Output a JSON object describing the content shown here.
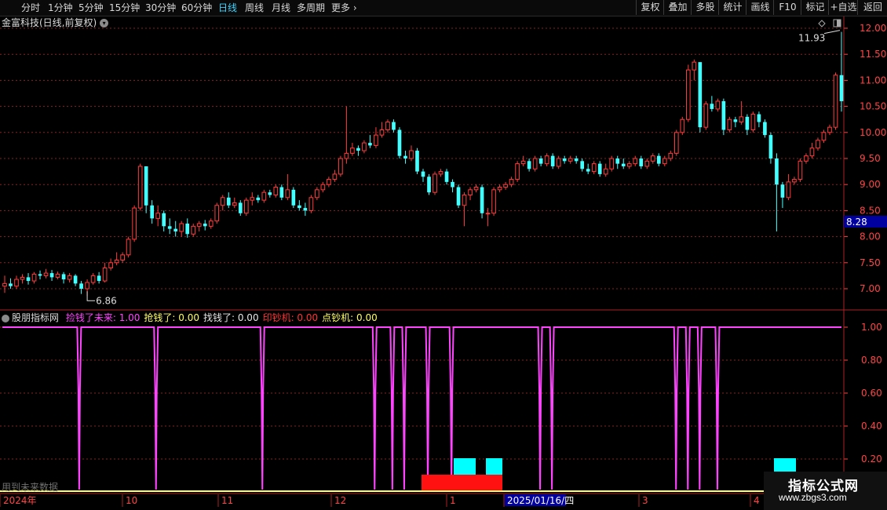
{
  "toolbar": {
    "periods": [
      "分时",
      "1分钟",
      "5分钟",
      "15分钟",
      "30分钟",
      "60分钟",
      "日线",
      "周线",
      "月线",
      "多周期"
    ],
    "more_label": "更多",
    "active_period": "日线",
    "right_buttons": [
      "复权",
      "叠加",
      "多股",
      "统计",
      "画线",
      "F10",
      "标记",
      "+自选",
      "返回"
    ]
  },
  "stock": {
    "title": "金富科技(日线,前复权)",
    "current_price_tag": "8.28",
    "high_label": "11.93",
    "low_label": "6.86"
  },
  "indicator": {
    "name": "股朋指标网",
    "items": [
      {
        "label": "捡钱了未来: 1.00",
        "color": "#ff44ff"
      },
      {
        "label": "抢钱了: 0.00",
        "color": "#ffff66"
      },
      {
        "label": "找钱了: 0.00",
        "color": "#e8e8e8"
      },
      {
        "label": "印钞机: 0.00",
        "color": "#ff3333"
      },
      {
        "label": "点钞机: 0.00",
        "color": "#ffff66"
      }
    ],
    "footnote": "用到未来数据"
  },
  "axes": {
    "price_ticks": [
      "12.00",
      "11.50",
      "11.00",
      "10.50",
      "10.00",
      "9.50",
      "9.00",
      "8.50",
      "8.00",
      "7.50",
      "7.00"
    ],
    "indicator_ticks": [
      "1.00",
      "0.80",
      "0.60",
      "0.40",
      "0.20"
    ],
    "time_labels": [
      "2024年",
      "10",
      "11",
      "12",
      "1",
      "2025/01/16/四",
      "3",
      "4"
    ]
  },
  "watermark": {
    "cn": "指标公式网",
    "en": "www.zbgs3.com"
  },
  "colors": {
    "up": "#ff3c3c",
    "down": "#44ffff",
    "indicator_line": "#ff44ff",
    "grid": "#882222",
    "baseline": "#ffff66"
  },
  "chart_data": [
    {
      "type": "candlestick",
      "series": [
        {
          "values": [
            [
              7.05,
              7.1,
              7.25,
              6.92
            ],
            [
              7.1,
              7.05,
              7.2,
              7.0
            ],
            [
              7.05,
              7.18,
              7.25,
              7.0
            ],
            [
              7.18,
              7.22,
              7.28,
              7.1
            ],
            [
              7.22,
              7.15,
              7.3,
              7.08
            ],
            [
              7.15,
              7.28,
              7.32,
              7.1
            ],
            [
              7.28,
              7.25,
              7.35,
              7.18
            ],
            [
              7.25,
              7.3,
              7.38,
              7.2
            ],
            [
              7.3,
              7.22,
              7.36,
              7.15
            ],
            [
              7.22,
              7.28,
              7.33,
              7.18
            ],
            [
              7.28,
              7.18,
              7.32,
              7.1
            ],
            [
              7.18,
              7.25,
              7.3,
              7.12
            ],
            [
              7.25,
              7.1,
              7.28,
              7.05
            ],
            [
              7.1,
              7.0,
              7.15,
              6.9
            ],
            [
              7.0,
              7.12,
              7.18,
              6.86
            ],
            [
              7.12,
              7.25,
              7.3,
              7.08
            ],
            [
              7.25,
              7.15,
              7.32,
              7.1
            ],
            [
              7.15,
              7.4,
              7.5,
              7.12
            ],
            [
              7.4,
              7.5,
              7.58,
              7.35
            ],
            [
              7.5,
              7.55,
              7.7,
              7.45
            ],
            [
              7.55,
              7.65,
              7.7,
              7.5
            ],
            [
              7.65,
              7.95,
              8.0,
              7.6
            ],
            [
              7.95,
              8.55,
              8.6,
              7.9
            ],
            [
              8.55,
              9.35,
              9.4,
              8.5
            ],
            [
              9.35,
              8.6,
              9.1,
              8.45
            ],
            [
              8.6,
              8.35,
              8.7,
              8.25
            ],
            [
              8.35,
              8.45,
              8.6,
              8.2
            ],
            [
              8.45,
              8.2,
              8.5,
              8.1
            ],
            [
              8.2,
              8.15,
              8.35,
              8.05
            ],
            [
              8.15,
              8.1,
              8.3,
              8.0
            ],
            [
              8.1,
              8.25,
              8.3,
              8.0
            ],
            [
              8.25,
              8.05,
              8.35,
              7.98
            ],
            [
              8.05,
              8.2,
              8.25,
              8.0
            ],
            [
              8.2,
              8.25,
              8.3,
              8.1
            ],
            [
              8.25,
              8.2,
              8.32,
              8.12
            ],
            [
              8.2,
              8.3,
              8.35,
              8.15
            ],
            [
              8.3,
              8.6,
              8.65,
              8.25
            ],
            [
              8.6,
              8.75,
              8.8,
              8.5
            ],
            [
              8.75,
              8.6,
              8.85,
              8.55
            ],
            [
              8.6,
              8.65,
              8.75,
              8.55
            ],
            [
              8.65,
              8.45,
              8.7,
              8.4
            ],
            [
              8.45,
              8.7,
              8.75,
              8.4
            ],
            [
              8.7,
              8.75,
              8.85,
              8.6
            ],
            [
              8.75,
              8.7,
              8.8,
              8.65
            ],
            [
              8.7,
              8.85,
              8.9,
              8.65
            ],
            [
              8.85,
              8.8,
              8.9,
              8.75
            ],
            [
              8.8,
              8.95,
              9.0,
              8.75
            ],
            [
              8.95,
              8.75,
              9.0,
              8.7
            ],
            [
              8.75,
              8.9,
              9.2,
              8.7
            ],
            [
              8.9,
              8.6,
              8.95,
              8.55
            ],
            [
              8.6,
              8.55,
              8.7,
              8.5
            ],
            [
              8.55,
              8.5,
              8.65,
              8.4
            ],
            [
              8.5,
              8.75,
              8.8,
              8.45
            ],
            [
              8.75,
              8.9,
              8.95,
              8.7
            ],
            [
              8.9,
              9.0,
              9.05,
              8.85
            ],
            [
              9.0,
              9.1,
              9.15,
              8.95
            ],
            [
              9.1,
              9.2,
              9.28,
              9.05
            ],
            [
              9.2,
              9.5,
              9.55,
              9.15
            ],
            [
              9.5,
              9.6,
              10.5,
              9.4
            ],
            [
              9.6,
              9.7,
              9.8,
              9.55
            ],
            [
              9.7,
              9.65,
              9.75,
              9.55
            ],
            [
              9.65,
              9.8,
              9.85,
              9.6
            ],
            [
              9.8,
              9.75,
              9.95,
              9.7
            ],
            [
              9.75,
              9.95,
              10.1,
              9.7
            ],
            [
              9.95,
              10.05,
              10.2,
              9.9
            ],
            [
              10.05,
              10.2,
              10.25,
              10.0
            ],
            [
              10.2,
              10.05,
              10.25,
              10.0
            ],
            [
              10.05,
              9.55,
              10.1,
              9.5
            ],
            [
              9.55,
              9.5,
              9.65,
              9.4
            ],
            [
              9.5,
              9.65,
              9.75,
              9.45
            ],
            [
              9.65,
              9.25,
              9.7,
              9.2
            ],
            [
              9.25,
              9.15,
              9.3,
              9.05
            ],
            [
              9.15,
              8.85,
              9.2,
              8.8
            ],
            [
              8.85,
              9.2,
              9.25,
              8.8
            ],
            [
              9.2,
              9.25,
              9.3,
              9.15
            ],
            [
              9.25,
              9.05,
              9.3,
              9.0
            ],
            [
              9.05,
              8.95,
              9.1,
              8.85
            ],
            [
              8.95,
              8.6,
              9.0,
              8.55
            ],
            [
              8.6,
              8.8,
              8.85,
              8.2
            ],
            [
              8.8,
              8.9,
              8.95,
              8.7
            ],
            [
              8.9,
              8.95,
              9.0,
              8.85
            ],
            [
              8.95,
              8.45,
              9.0,
              8.35
            ],
            [
              8.45,
              8.45,
              8.55,
              8.2
            ],
            [
              8.45,
              8.9,
              8.95,
              8.4
            ],
            [
              8.9,
              8.95,
              9.0,
              8.85
            ],
            [
              8.95,
              9.0,
              9.05,
              8.9
            ],
            [
              9.0,
              9.1,
              9.15,
              8.95
            ],
            [
              9.1,
              9.4,
              9.45,
              9.05
            ],
            [
              9.4,
              9.45,
              9.55,
              9.35
            ],
            [
              9.45,
              9.3,
              9.5,
              9.25
            ],
            [
              9.3,
              9.5,
              9.55,
              9.25
            ],
            [
              9.5,
              9.4,
              9.55,
              9.35
            ],
            [
              9.4,
              9.55,
              9.6,
              9.35
            ],
            [
              9.55,
              9.35,
              9.6,
              9.3
            ],
            [
              9.35,
              9.5,
              9.55,
              9.3
            ],
            [
              9.5,
              9.45,
              9.55,
              9.4
            ],
            [
              9.45,
              9.5,
              9.55,
              9.4
            ],
            [
              9.5,
              9.45,
              9.55,
              9.4
            ],
            [
              9.45,
              9.3,
              9.5,
              9.25
            ],
            [
              9.3,
              9.25,
              9.4,
              9.2
            ],
            [
              9.25,
              9.4,
              9.45,
              9.2
            ],
            [
              9.4,
              9.2,
              9.45,
              9.15
            ],
            [
              9.2,
              9.3,
              9.4,
              9.15
            ],
            [
              9.3,
              9.5,
              9.55,
              9.25
            ],
            [
              9.5,
              9.4,
              9.55,
              9.3
            ],
            [
              9.4,
              9.35,
              9.5,
              9.3
            ],
            [
              9.35,
              9.4,
              9.45,
              9.3
            ],
            [
              9.4,
              9.5,
              9.55,
              9.35
            ],
            [
              9.5,
              9.35,
              9.55,
              9.3
            ],
            [
              9.35,
              9.45,
              9.5,
              9.3
            ],
            [
              9.45,
              9.55,
              9.6,
              9.4
            ],
            [
              9.55,
              9.4,
              9.6,
              9.35
            ],
            [
              9.4,
              9.5,
              9.55,
              9.35
            ],
            [
              9.5,
              9.6,
              9.65,
              9.45
            ],
            [
              9.6,
              10.0,
              10.05,
              9.55
            ],
            [
              10.0,
              10.25,
              10.3,
              9.95
            ],
            [
              10.25,
              11.2,
              11.3,
              10.2
            ],
            [
              11.2,
              11.35,
              11.4,
              11.0
            ],
            [
              11.35,
              10.1,
              11.2,
              10.0
            ],
            [
              10.1,
              10.55,
              10.6,
              10.05
            ],
            [
              10.55,
              10.45,
              10.7,
              10.4
            ],
            [
              10.45,
              10.6,
              10.65,
              10.4
            ],
            [
              10.6,
              10.05,
              10.65,
              9.95
            ],
            [
              10.05,
              10.25,
              10.3,
              10.0
            ],
            [
              10.25,
              10.2,
              10.3,
              10.1
            ],
            [
              10.2,
              10.3,
              10.6,
              10.15
            ],
            [
              10.3,
              10.05,
              10.35,
              9.95
            ],
            [
              10.05,
              10.35,
              10.4,
              10.0
            ],
            [
              10.35,
              10.2,
              10.4,
              10.1
            ],
            [
              10.2,
              9.95,
              10.25,
              9.9
            ],
            [
              9.95,
              9.5,
              10.0,
              9.4
            ],
            [
              9.5,
              9.0,
              9.6,
              8.1
            ],
            [
              9.0,
              8.75,
              9.05,
              8.55
            ],
            [
              8.75,
              9.05,
              9.2,
              8.7
            ],
            [
              9.05,
              9.1,
              9.15,
              9.0
            ],
            [
              9.1,
              9.45,
              9.5,
              9.05
            ],
            [
              9.45,
              9.55,
              9.6,
              9.4
            ],
            [
              9.55,
              9.7,
              9.8,
              9.5
            ],
            [
              9.7,
              9.85,
              9.9,
              9.65
            ],
            [
              9.85,
              10.0,
              10.05,
              9.8
            ],
            [
              10.0,
              10.1,
              10.15,
              9.95
            ],
            [
              10.1,
              11.1,
              11.15,
              10.05
            ],
            [
              11.1,
              10.6,
              11.93,
              10.4
            ]
          ]
        }
      ]
    },
    {
      "type": "line",
      "series": [
        {
          "name": "捡钱了未来",
          "values": [
            1,
            1,
            1,
            1,
            1,
            1,
            1,
            1,
            1,
            1,
            1,
            1,
            1,
            1,
            1,
            1,
            1,
            1,
            1,
            1,
            1,
            1,
            1,
            1,
            1,
            1,
            1,
            1,
            1,
            1,
            1,
            1,
            1,
            1,
            1,
            1,
            1,
            1,
            1,
            1,
            1,
            1,
            1,
            1,
            1,
            1,
            1,
            1,
            1,
            1,
            1,
            1,
            1,
            1,
            1,
            1,
            1,
            1,
            1,
            1,
            1,
            1,
            1,
            1,
            1,
            1,
            1,
            1,
            1,
            1,
            1,
            1,
            1,
            1,
            1,
            1,
            1,
            1,
            1,
            1,
            1,
            1,
            1,
            1,
            1,
            1,
            1,
            1,
            1,
            1,
            1,
            1,
            1,
            1,
            1,
            1,
            1,
            1,
            1,
            1,
            1,
            1,
            1,
            1,
            1,
            1,
            1,
            1,
            1,
            1,
            1,
            1,
            1,
            1,
            1,
            1,
            1,
            1,
            1,
            1,
            1,
            1,
            1,
            1,
            1,
            1,
            1,
            1,
            1,
            1,
            1,
            1,
            1,
            1,
            1,
            1,
            1,
            1,
            1,
            1,
            1,
            1,
            1,
            1,
            1,
            1
          ]
        }
      ],
      "dips_at_index": [
        13,
        26,
        44,
        63,
        66,
        68,
        72,
        76,
        91,
        93,
        114,
        116,
        118,
        121
      ],
      "ylim": [
        0,
        1.0
      ]
    }
  ]
}
